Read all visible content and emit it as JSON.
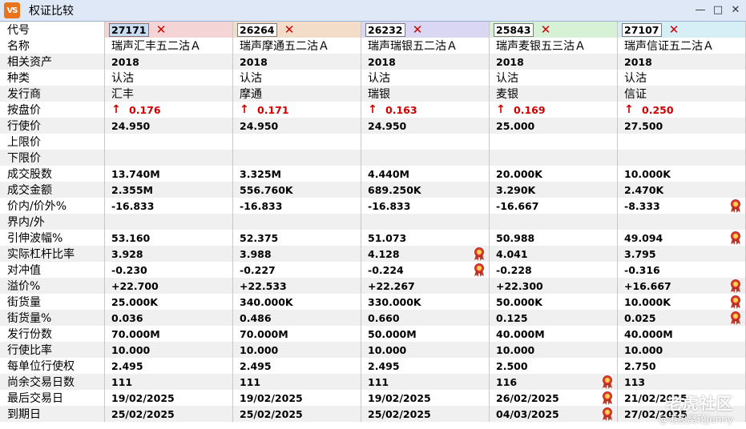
{
  "window": {
    "title": "权证比较",
    "app_icon_text": "VS"
  },
  "colors": {
    "header_tints": [
      "#f4d4d4",
      "#f3ddc9",
      "#d9d7f3",
      "#d6f1d6",
      "#d6eef6"
    ],
    "row_alt": "#f0f0f0",
    "up": "#d00000"
  },
  "header_label": "代号",
  "warrants": [
    {
      "code": "27171",
      "name": "瑞声汇丰五二沽Ａ",
      "asset": "2018",
      "type": "认沽",
      "issuer": "汇丰",
      "price": "0.176",
      "strike": "24.950",
      "cap": "",
      "floor": "",
      "volume": "13.740M",
      "turnover": "2.355M",
      "moneyness": "-16.833",
      "range": "",
      "iv": "53.160",
      "eff_gearing": "3.928",
      "delta": "-0.230",
      "premium": "+22.700",
      "outstanding": "25.000K",
      "outstanding_pct": "0.036",
      "issue_size": "70.000M",
      "conv_ratio": "10.000",
      "exercise_per_unit": "2.495",
      "days_left": "111",
      "last_trade": "19/02/2025",
      "expiry": "25/02/2025"
    },
    {
      "code": "26264",
      "name": "瑞声摩通五二沽Ａ",
      "asset": "2018",
      "type": "认沽",
      "issuer": "摩通",
      "price": "0.171",
      "strike": "24.950",
      "cap": "",
      "floor": "",
      "volume": "3.325M",
      "turnover": "556.760K",
      "moneyness": "-16.833",
      "range": "",
      "iv": "52.375",
      "eff_gearing": "3.988",
      "delta": "-0.227",
      "premium": "+22.533",
      "outstanding": "340.000K",
      "outstanding_pct": "0.486",
      "issue_size": "70.000M",
      "conv_ratio": "10.000",
      "exercise_per_unit": "2.495",
      "days_left": "111",
      "last_trade": "19/02/2025",
      "expiry": "25/02/2025"
    },
    {
      "code": "26232",
      "name": "瑞声瑞银五二沽Ａ",
      "asset": "2018",
      "type": "认沽",
      "issuer": "瑞银",
      "price": "0.163",
      "strike": "24.950",
      "cap": "",
      "floor": "",
      "volume": "4.440M",
      "turnover": "689.250K",
      "moneyness": "-16.833",
      "range": "",
      "iv": "51.073",
      "eff_gearing": "4.128",
      "delta": "-0.224",
      "premium": "+22.267",
      "outstanding": "330.000K",
      "outstanding_pct": "0.660",
      "issue_size": "50.000M",
      "conv_ratio": "10.000",
      "exercise_per_unit": "2.495",
      "days_left": "111",
      "last_trade": "19/02/2025",
      "expiry": "25/02/2025"
    },
    {
      "code": "25843",
      "name": "瑞声麦银五三沽Ａ",
      "asset": "2018",
      "type": "认沽",
      "issuer": "麦银",
      "price": "0.169",
      "strike": "25.000",
      "cap": "",
      "floor": "",
      "volume": "20.000K",
      "turnover": "3.290K",
      "moneyness": "-16.667",
      "range": "",
      "iv": "50.988",
      "eff_gearing": "4.041",
      "delta": "-0.228",
      "premium": "+22.300",
      "outstanding": "50.000K",
      "outstanding_pct": "0.125",
      "issue_size": "40.000M",
      "conv_ratio": "10.000",
      "exercise_per_unit": "2.500",
      "days_left": "116",
      "last_trade": "26/02/2025",
      "expiry": "04/03/2025"
    },
    {
      "code": "27107",
      "name": "瑞声信证五二沽Ａ",
      "asset": "2018",
      "type": "认沽",
      "issuer": "信证",
      "price": "0.250",
      "strike": "27.500",
      "cap": "",
      "floor": "",
      "volume": "10.000K",
      "turnover": "2.470K",
      "moneyness": "-8.333",
      "range": "",
      "iv": "49.094",
      "eff_gearing": "3.795",
      "delta": "-0.316",
      "premium": "+16.667",
      "outstanding": "10.000K",
      "outstanding_pct": "0.025",
      "issue_size": "40.000M",
      "conv_ratio": "10.000",
      "exercise_per_unit": "2.750",
      "days_left": "113",
      "last_trade": "21/02/2025",
      "expiry": "27/02/2025"
    }
  ],
  "rows": [
    {
      "label": "名称",
      "field": "name",
      "kind": "cjk"
    },
    {
      "label": "相关资产",
      "field": "asset",
      "kind": "num"
    },
    {
      "label": "种类",
      "field": "type",
      "kind": "cjk"
    },
    {
      "label": "发行商",
      "field": "issuer",
      "kind": "cjk"
    },
    {
      "label": "按盘价",
      "field": "price",
      "kind": "price"
    },
    {
      "label": "行使价",
      "field": "strike",
      "kind": "num"
    },
    {
      "label": "上限价",
      "field": "cap",
      "kind": "num"
    },
    {
      "label": "下限价",
      "field": "floor",
      "kind": "num"
    },
    {
      "label": "成交股数",
      "field": "volume",
      "kind": "num"
    },
    {
      "label": "成交金额",
      "field": "turnover",
      "kind": "num"
    },
    {
      "label": "价内/价外%",
      "field": "moneyness",
      "kind": "num"
    },
    {
      "label": "界内/外",
      "field": "range",
      "kind": "num"
    },
    {
      "label": "引伸波幅%",
      "field": "iv",
      "kind": "num"
    },
    {
      "label": "实际杠杆比率",
      "field": "eff_gearing",
      "kind": "num"
    },
    {
      "label": "对冲值",
      "field": "delta",
      "kind": "num"
    },
    {
      "label": "溢价%",
      "field": "premium",
      "kind": "num"
    },
    {
      "label": "街货量",
      "field": "outstanding",
      "kind": "num"
    },
    {
      "label": "街货量%",
      "field": "outstanding_pct",
      "kind": "num"
    },
    {
      "label": "发行份数",
      "field": "issue_size",
      "kind": "num"
    },
    {
      "label": "行使比率",
      "field": "conv_ratio",
      "kind": "num"
    },
    {
      "label": "每单位行使权",
      "field": "exercise_per_unit",
      "kind": "num"
    },
    {
      "label": "尚余交易日数",
      "field": "days_left",
      "kind": "num"
    },
    {
      "label": "最后交易日",
      "field": "last_trade",
      "kind": "num"
    },
    {
      "label": "到期日",
      "field": "expiry",
      "kind": "num"
    }
  ],
  "best_badges": {
    "moneyness": [
      4
    ],
    "iv": [
      4
    ],
    "eff_gearing": [
      2
    ],
    "delta": [
      2
    ],
    "premium": [
      4
    ],
    "outstanding": [
      4
    ],
    "outstanding_pct": [
      4
    ],
    "days_left": [
      3
    ],
    "last_trade": [
      3
    ],
    "expiry": [
      3
    ]
  },
  "watermark": {
    "logo": "老虎社区",
    "user": "@港股窝轮Jenny"
  }
}
